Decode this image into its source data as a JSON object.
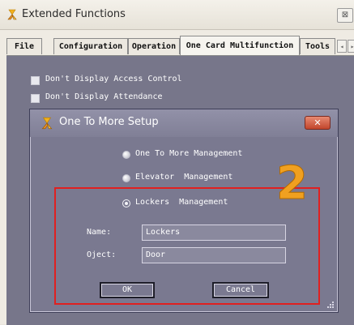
{
  "window": {
    "title": "Extended Functions",
    "close_glyph": "⊠",
    "icon": "app-icon"
  },
  "tabs": [
    {
      "label": "File",
      "active": false
    },
    {
      "label": "Configuration",
      "active": false
    },
    {
      "label": "Operation",
      "active": false
    },
    {
      "label": "One Card Multifunction",
      "active": true
    },
    {
      "label": "Tools",
      "active": false
    }
  ],
  "tab_scroll": {
    "left_glyph": "◂",
    "right_glyph": "▸"
  },
  "options": [
    {
      "label": "Don't Display Access Control",
      "checked": false
    },
    {
      "label": "Don't Display Attendance",
      "checked": false
    }
  ],
  "dialog": {
    "title": "One To More Setup",
    "close_glyph": "✕",
    "radios": [
      {
        "label": "One To More Management",
        "selected": false
      },
      {
        "label": "Elevator  Management",
        "selected": false
      },
      {
        "label": "Lockers  Management",
        "selected": true
      }
    ],
    "name_label": "Name:",
    "name_value": "Lockers",
    "object_label": "Oject:",
    "object_value": "Door",
    "ok_label": "OK",
    "cancel_label": "Cancel"
  },
  "annotation": {
    "number": "2",
    "color": "#f0a020",
    "box_color": "#e02020"
  },
  "colors": {
    "panel": "#77768a",
    "dialog": "#7a7990",
    "close_red": "#c2462c"
  }
}
